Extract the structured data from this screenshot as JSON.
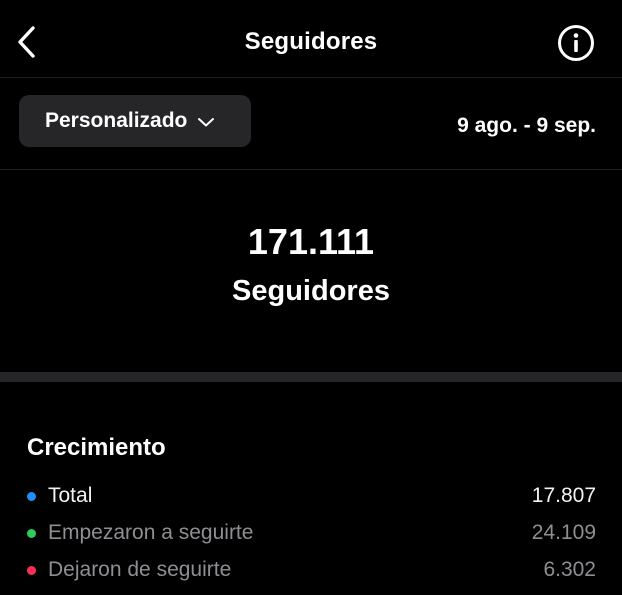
{
  "header": {
    "title": "Seguidores",
    "back_icon": "chevron-left-icon",
    "info_icon": "info-circle-icon"
  },
  "filter": {
    "range_label": "Personalizado",
    "dropdown_icon": "chevron-down-icon",
    "date_range": "9 ago. - 9 sep."
  },
  "summary": {
    "count": "171.111",
    "label": "Seguidores"
  },
  "growth": {
    "title": "Crecimiento",
    "metrics": [
      {
        "label": "Total",
        "value": "17.807",
        "color": "#1f8fff"
      },
      {
        "label": "Empezaron a seguirte",
        "value": "24.109",
        "color": "#2ecc5a"
      },
      {
        "label": "Dejaron de seguirte",
        "value": "6.302",
        "color": "#ff2d55"
      }
    ]
  },
  "colors": {
    "background": "#000000",
    "surface": "#262628",
    "divider": "#1c1c1e",
    "muted_text": "#8e8e93"
  }
}
